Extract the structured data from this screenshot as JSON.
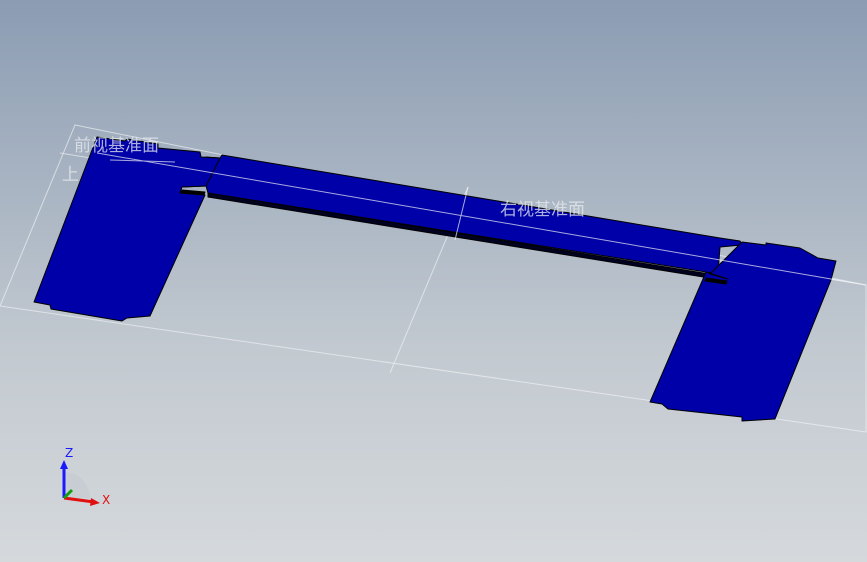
{
  "viewport": {
    "background_top": "#8b9cb3",
    "background_bottom": "#d5d9dc",
    "part_color": "#0000a8",
    "part_edge_color": "#000000",
    "plane_color": "#f2f4f6"
  },
  "planes": {
    "front_plane_label": "前视基准面",
    "top_plane_label": "上",
    "right_plane_label": "右视基准面"
  },
  "triad": {
    "z_label": "Z",
    "x_label": "X",
    "z_color": "#1a1aff",
    "x_color": "#e01010",
    "y_color": "#10a010"
  }
}
